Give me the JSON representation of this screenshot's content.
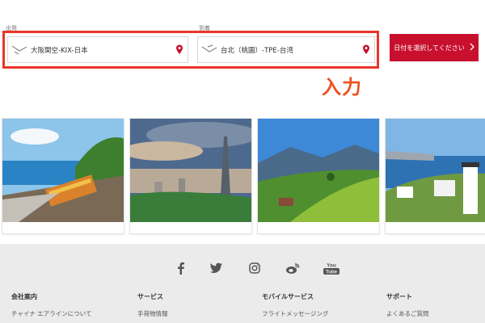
{
  "search": {
    "origin_label": "出発",
    "origin_value": "大阪関空-KIX-日本",
    "dest_label": "到着",
    "dest_value": "台北（桃園）-TPE-台湾",
    "date_button": "日付を選択してください",
    "annotation": "入力",
    "accent_color": "#c8102e",
    "highlight_color": "#e8362a"
  },
  "social": [
    "facebook-icon",
    "twitter-icon",
    "instagram-icon",
    "weibo-icon",
    "youtube-icon"
  ],
  "social_youtube_text": "You\nTube",
  "footer": {
    "columns": [
      {
        "title": "会社案内",
        "link": "チャイナ エアラインについて"
      },
      {
        "title": "サービス",
        "link": "手荷物情報"
      },
      {
        "title": "モバイルサービス",
        "link": "フライトメッセージング"
      },
      {
        "title": "サポート",
        "link": "よくあるご質問"
      }
    ]
  }
}
